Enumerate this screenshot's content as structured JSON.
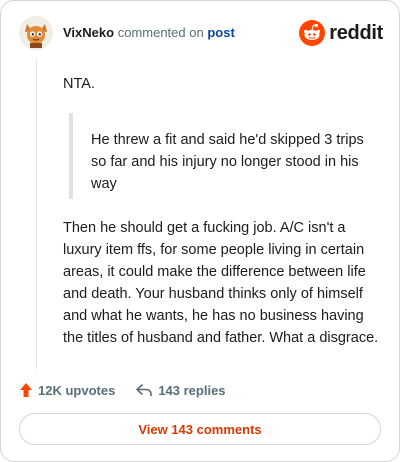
{
  "comment": {
    "username": "VixNeko",
    "action_text": "commented on",
    "post_link": "post",
    "paragraph_1": "NTA.",
    "quote": "He threw a fit and said he'd skipped 3 trips so far and his injury no longer stood in his way",
    "paragraph_2": "Then he should get a fucking job. A/C isn't a luxury item ffs, for some people living in certain areas, it could make the difference between life and death. Your husband thinks only of himself and what he wants, he has no business having the titles of husband and father. What a disgrace."
  },
  "brand": {
    "name": "reddit",
    "color": "#ff4500"
  },
  "actions": {
    "upvotes": "12K upvotes",
    "replies": "143 replies",
    "upvote_color": "#ff4500"
  },
  "footer": {
    "view_comments": "View 143 comments",
    "button_text_color": "#d93900"
  }
}
